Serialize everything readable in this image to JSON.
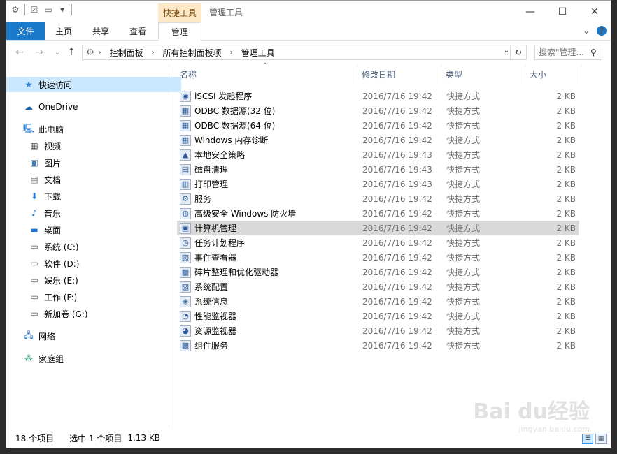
{
  "titlebar": {
    "contextual_group": "快捷工具",
    "window_title": "管理工具"
  },
  "ribbon": {
    "tabs": [
      {
        "label": "文件",
        "kind": "file"
      },
      {
        "label": "主页"
      },
      {
        "label": "共享"
      },
      {
        "label": "查看"
      },
      {
        "label": "管理",
        "active": true
      }
    ]
  },
  "address": {
    "breadcrumbs": [
      "控制面板",
      "所有控制面板项",
      "管理工具"
    ]
  },
  "search": {
    "placeholder": "搜索\"管理..."
  },
  "navpane": {
    "items": [
      {
        "label": "快速访问",
        "icon": "star-icon",
        "selected": true
      },
      {
        "label": "OneDrive",
        "icon": "cloud-icon"
      },
      {
        "label": "此电脑",
        "icon": "computer-icon"
      },
      {
        "label": "视频",
        "icon": "video-icon"
      },
      {
        "label": "图片",
        "icon": "picture-icon"
      },
      {
        "label": "文档",
        "icon": "document-icon"
      },
      {
        "label": "下载",
        "icon": "download-icon"
      },
      {
        "label": "音乐",
        "icon": "music-icon"
      },
      {
        "label": "桌面",
        "icon": "desktop-icon"
      },
      {
        "label": "系统 (C:)",
        "icon": "drive-icon"
      },
      {
        "label": "软件 (D:)",
        "icon": "drive-icon"
      },
      {
        "label": "娱乐 (E:)",
        "icon": "drive-icon"
      },
      {
        "label": "工作 (F:)",
        "icon": "drive-icon"
      },
      {
        "label": "新加卷 (G:)",
        "icon": "drive-icon"
      },
      {
        "label": "网络",
        "icon": "network-icon"
      },
      {
        "label": "家庭组",
        "icon": "homegroup-icon"
      }
    ]
  },
  "columns": {
    "name": "名称",
    "date": "修改日期",
    "type": "类型",
    "size": "大小"
  },
  "files": [
    {
      "name": "iSCSI 发起程序",
      "date": "2016/7/16 19:42",
      "type": "快捷方式",
      "size": "2 KB"
    },
    {
      "name": "ODBC 数据源(32 位)",
      "date": "2016/7/16 19:42",
      "type": "快捷方式",
      "size": "2 KB"
    },
    {
      "name": "ODBC 数据源(64 位)",
      "date": "2016/7/16 19:42",
      "type": "快捷方式",
      "size": "2 KB"
    },
    {
      "name": "Windows 内存诊断",
      "date": "2016/7/16 19:42",
      "type": "快捷方式",
      "size": "2 KB"
    },
    {
      "name": "本地安全策略",
      "date": "2016/7/16 19:43",
      "type": "快捷方式",
      "size": "2 KB"
    },
    {
      "name": "磁盘清理",
      "date": "2016/7/16 19:43",
      "type": "快捷方式",
      "size": "2 KB"
    },
    {
      "name": "打印管理",
      "date": "2016/7/16 19:43",
      "type": "快捷方式",
      "size": "2 KB"
    },
    {
      "name": "服务",
      "date": "2016/7/16 19:42",
      "type": "快捷方式",
      "size": "2 KB"
    },
    {
      "name": "高级安全 Windows 防火墙",
      "date": "2016/7/16 19:42",
      "type": "快捷方式",
      "size": "2 KB"
    },
    {
      "name": "计算机管理",
      "date": "2016/7/16 19:42",
      "type": "快捷方式",
      "size": "2 KB",
      "selected": true
    },
    {
      "name": "任务计划程序",
      "date": "2016/7/16 19:42",
      "type": "快捷方式",
      "size": "2 KB"
    },
    {
      "name": "事件查看器",
      "date": "2016/7/16 19:42",
      "type": "快捷方式",
      "size": "2 KB"
    },
    {
      "name": "碎片整理和优化驱动器",
      "date": "2016/7/16 19:42",
      "type": "快捷方式",
      "size": "2 KB"
    },
    {
      "name": "系统配置",
      "date": "2016/7/16 19:42",
      "type": "快捷方式",
      "size": "2 KB"
    },
    {
      "name": "系统信息",
      "date": "2016/7/16 19:42",
      "type": "快捷方式",
      "size": "2 KB"
    },
    {
      "name": "性能监视器",
      "date": "2016/7/16 19:42",
      "type": "快捷方式",
      "size": "2 KB"
    },
    {
      "name": "资源监视器",
      "date": "2016/7/16 19:42",
      "type": "快捷方式",
      "size": "2 KB"
    },
    {
      "name": "组件服务",
      "date": "2016/7/16 19:42",
      "type": "快捷方式",
      "size": "2 KB"
    }
  ],
  "status": {
    "count": "18 个项目",
    "selection": "选中 1 个项目",
    "size": "1.13 KB"
  },
  "watermark": {
    "text": "Bai du经验",
    "url": "jingyan.baidu.com"
  },
  "colors": {
    "accent": "#1979ca",
    "context_tab": "#fde8c8",
    "selection": "#cce8ff",
    "row_selection": "#d9d9d9"
  }
}
